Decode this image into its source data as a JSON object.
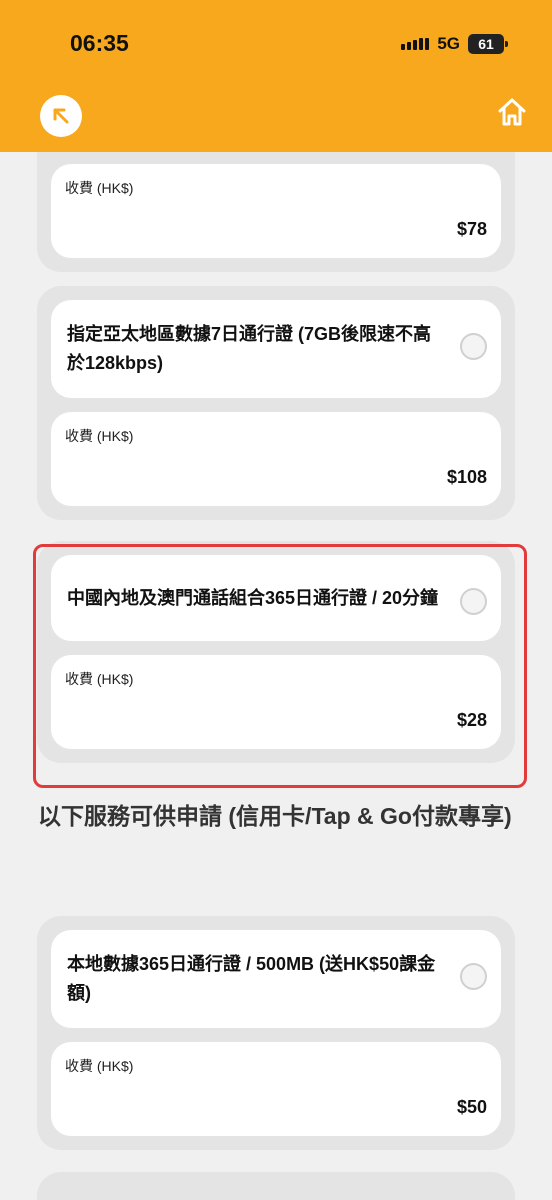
{
  "status": {
    "time": "06:35",
    "network": "5G",
    "battery": "61"
  },
  "nav": {
    "back_icon": "arrow-up-left-icon",
    "home_icon": "home-icon"
  },
  "plans": [
    {
      "fee_label": "收費 (HK$)",
      "fee_value": "$78"
    },
    {
      "title": "指定亞太地區數據7日通行證 (7GB後限速不高於128kbps)",
      "fee_label": "收費 (HK$)",
      "fee_value": "$108"
    },
    {
      "title": "中國內地及澳門通話組合365日通行證 / 20分鐘",
      "fee_label": "收費 (HK$)",
      "fee_value": "$28"
    }
  ],
  "section": {
    "heading": "以下服務可供申請 (信用卡/Tap & Go付款專享)"
  },
  "plans2": [
    {
      "title": "本地數據365日通行證 / 500MB (送HK$50課金額)",
      "fee_label": "收費 (HK$)",
      "fee_value": "$50"
    }
  ],
  "colors": {
    "header": "#f8a81c",
    "highlight": "#e23b3b"
  }
}
